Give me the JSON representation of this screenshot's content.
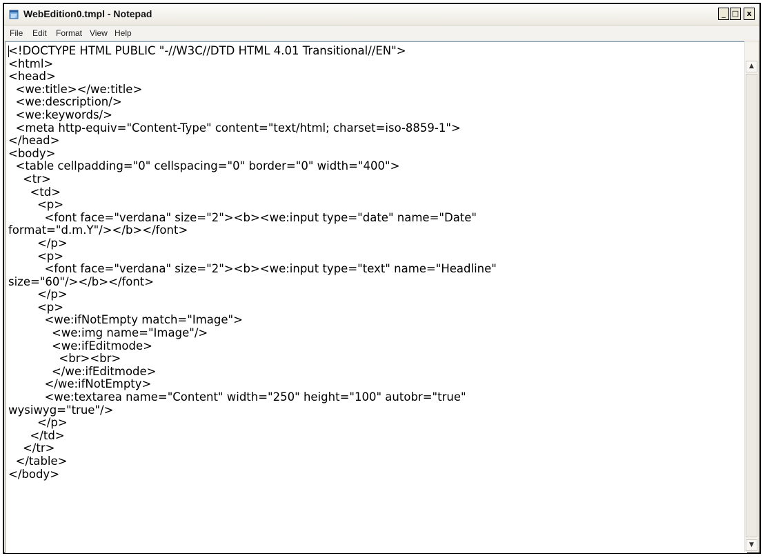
{
  "window": {
    "title": "WebEdition0.tmpl - Notepad",
    "controls": {
      "minimize": "_",
      "maximize": "□",
      "close": "x"
    }
  },
  "menu": {
    "items": [
      "File",
      "Edit",
      "Format",
      "View",
      "Help"
    ]
  },
  "editor": {
    "lines": [
      "<!DOCTYPE HTML PUBLIC \"-//W3C//DTD HTML 4.01 Transitional//EN\">",
      "<html>",
      "<head>",
      "  <we:title></we:title>",
      "  <we:description/>",
      "  <we:keywords/>",
      "  <meta http-equiv=\"Content-Type\" content=\"text/html; charset=iso-8859-1\">",
      "</head>",
      "<body>",
      "  <table cellpadding=\"0\" cellspacing=\"0\" border=\"0\" width=\"400\">",
      "    <tr>",
      "      <td>",
      "        <p>",
      "          <font face=\"verdana\" size=\"2\"><b><we:input type=\"date\" name=\"Date\"",
      "format=\"d.m.Y\"/></b></font>",
      "        </p>",
      "        <p>",
      "          <font face=\"verdana\" size=\"2\"><b><we:input type=\"text\" name=\"Headline\"",
      "size=\"60\"/></b></font>",
      "        </p>",
      "        <p>",
      "          <we:ifNotEmpty match=\"Image\">",
      "            <we:img name=\"Image\"/>",
      "            <we:ifEditmode>",
      "              <br><br>",
      "            </we:ifEditmode>",
      "          </we:ifNotEmpty>",
      "          <we:textarea name=\"Content\" width=\"250\" height=\"100\" autobr=\"true\"",
      "wysiwyg=\"true\"/>",
      "        </p>",
      "      </td>",
      "    </tr>",
      "  </table>",
      "</body>"
    ]
  },
  "scrollbar": {
    "up_arrow": "▲",
    "down_arrow": "▼"
  },
  "icons": {
    "app": "notepad-icon"
  },
  "colors": {
    "window_frame": "#000000",
    "titlebar": "#f5f4ef",
    "menubar": "#f3f2ee",
    "editor_bg": "#ffffff",
    "text": "#000000"
  }
}
